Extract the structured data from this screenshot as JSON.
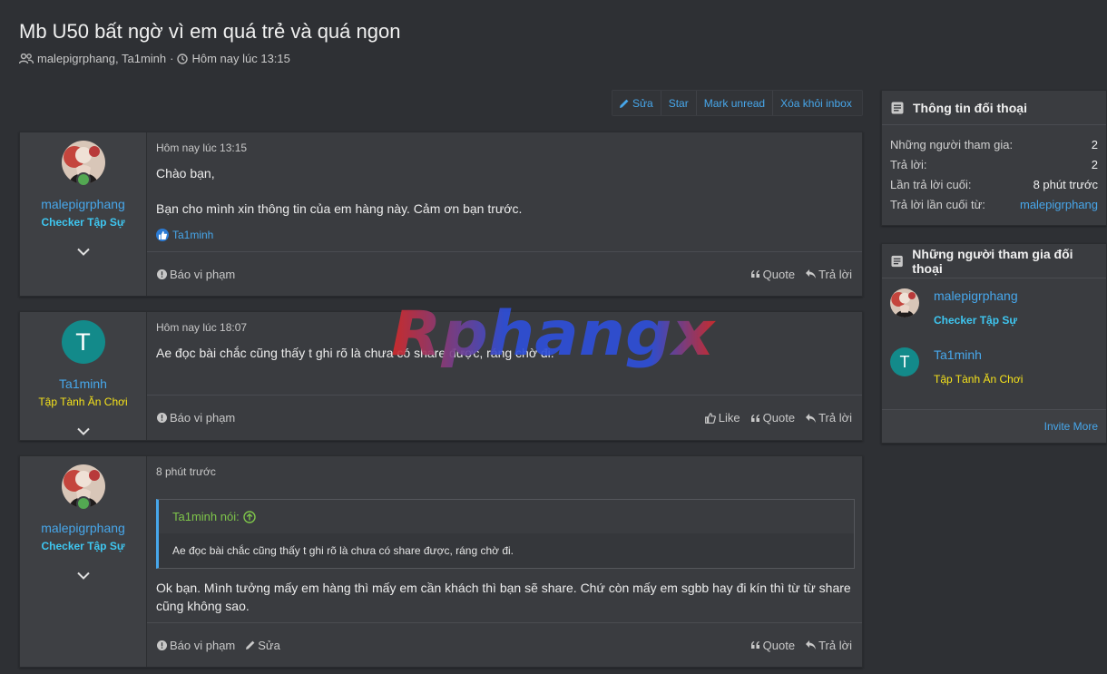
{
  "header": {
    "title": "Mb U50 bất ngờ vì em quá trẻ và quá ngon",
    "participants": "malepigrphang, Ta1minh",
    "separator": "·",
    "time": "Hôm nay lúc 13:15"
  },
  "actions": {
    "edit": "Sửa",
    "star": "Star",
    "mark_unread": "Mark unread",
    "remove_inbox": "Xóa khỏi inbox"
  },
  "messages": [
    {
      "time": "Hôm nay lúc 13:15",
      "username": "malepigrphang",
      "user_title": "Checker Tập Sự",
      "body_line1": "Chào bạn,",
      "body_line2": "Bạn cho mình xin thông tin của em hàng này. Cảm ơn bạn trước.",
      "liked_by": "Ta1minh",
      "report": "Báo vi phạm",
      "quote": "Quote",
      "reply": "Trả lời"
    },
    {
      "time": "Hôm nay lúc 18:07",
      "username": "Ta1minh",
      "avatar_letter": "T",
      "user_title": "Tập Tành Ăn Chơi",
      "body": "Ae đọc bài chắc cũng thấy t ghi rõ là chưa có share được, ráng chờ đi.",
      "report": "Báo vi phạm",
      "like": "Like",
      "quote": "Quote",
      "reply": "Trả lời"
    },
    {
      "time": "8 phút trước",
      "username": "malepigrphang",
      "user_title": "Checker Tập Sự",
      "quote_author": "Ta1minh nói:",
      "quote_text": "Ae đọc bài chắc cũng thấy t ghi rõ là chưa có share được, ráng chờ đi.",
      "body_line1": "Ok bạn. Mình tưởng mấy em hàng thì mấy em cần khách thì bạn sẽ share. Chứ còn mấy em sgbb hay đi kín thì từ từ share",
      "body_line2": "cũng không sao.",
      "report": "Báo vi phạm",
      "edit": "Sửa",
      "quote": "Quote",
      "reply": "Trả lời"
    }
  ],
  "sidebar": {
    "info": {
      "title": "Thông tin đối thoại",
      "rows": [
        {
          "label": "Những người tham gia:",
          "value": "2"
        },
        {
          "label": "Trả lời:",
          "value": "2"
        },
        {
          "label": "Lần trả lời cuối:",
          "value": "8 phút trước"
        },
        {
          "label": "Trả lời lần cuối từ:",
          "value": "malepigrphang"
        }
      ]
    },
    "participants": {
      "title": "Những người tham gia đối thoại",
      "list": [
        {
          "name": "malepigrphang",
          "title": "Checker Tập Sự"
        },
        {
          "name": "Ta1minh",
          "title": "Tập Tành Ăn Chơi",
          "avatar_letter": "T"
        }
      ],
      "invite": "Invite More"
    }
  },
  "watermark": {
    "text": "Rphangx"
  },
  "colors": {
    "background": "#2e3034",
    "panel": "#3a3c40",
    "link": "#47a7eb",
    "title_cyan": "#3ec6f0",
    "title_yellow": "#f5e21b",
    "quote_green": "#7ec54a",
    "avatar_teal": "#138a8a"
  }
}
